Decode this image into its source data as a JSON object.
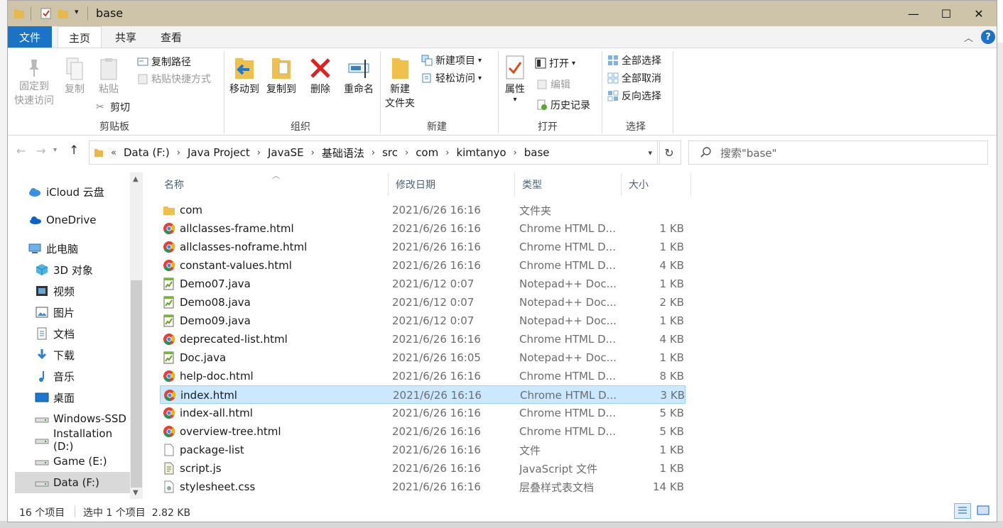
{
  "window": {
    "title": "base",
    "minimize": "—",
    "maximize": "☐",
    "close": "✕"
  },
  "ribbon_tabs": [
    "文件",
    "主页",
    "共享",
    "查看"
  ],
  "ribbon": {
    "clipboard": {
      "pin_line1": "固定到",
      "pin_line2": "快速访问",
      "copy": "复制",
      "paste": "粘贴",
      "copy_path": "复制路径",
      "paste_shortcut": "粘贴快捷方式",
      "cut": "剪切",
      "label": "剪贴板"
    },
    "organize": {
      "move_to": "移动到",
      "copy_to": "复制到",
      "delete": "删除",
      "rename": "重命名",
      "label": "组织"
    },
    "new": {
      "new_folder_line1": "新建",
      "new_folder_line2": "文件夹",
      "new_item": "新建项目",
      "easy_access": "轻松访问",
      "label": "新建"
    },
    "open": {
      "properties": "属性",
      "open": "打开",
      "edit": "编辑",
      "history": "历史记录",
      "label": "打开"
    },
    "select": {
      "select_all": "全部选择",
      "select_none": "全部取消",
      "invert": "反向选择",
      "label": "选择"
    }
  },
  "address": {
    "crumbs": [
      "Data (F:)",
      "Java Project",
      "JavaSE",
      "基础语法",
      "src",
      "com",
      "kimtanyo",
      "base"
    ],
    "overflow": "«",
    "search_placeholder": "搜索\"base\""
  },
  "nav": [
    {
      "label": "iCloud 云盘",
      "icon": "icloud-icon"
    },
    {
      "label": "OneDrive",
      "icon": "onedrive-icon"
    },
    {
      "label": "此电脑",
      "icon": "this-pc-icon"
    },
    {
      "label": "3D 对象",
      "icon": "3d-objects-icon"
    },
    {
      "label": "视频",
      "icon": "videos-icon"
    },
    {
      "label": "图片",
      "icon": "pictures-icon"
    },
    {
      "label": "文档",
      "icon": "documents-icon"
    },
    {
      "label": "下载",
      "icon": "downloads-icon"
    },
    {
      "label": "音乐",
      "icon": "music-icon"
    },
    {
      "label": "桌面",
      "icon": "desktop-icon"
    },
    {
      "label": "Windows-SSD",
      "icon": "drive-icon"
    },
    {
      "label": "Installation (D:)",
      "icon": "drive-icon"
    },
    {
      "label": "Game (E:)",
      "icon": "drive-icon"
    },
    {
      "label": "Data (F:)",
      "icon": "drive-icon"
    }
  ],
  "columns": {
    "name": "名称",
    "date": "修改日期",
    "type": "类型",
    "size": "大小"
  },
  "files": [
    {
      "name": "com",
      "date": "2021/6/26 16:16",
      "type": "文件夹",
      "size": "",
      "icon": "folder"
    },
    {
      "name": "allclasses-frame.html",
      "date": "2021/6/26 16:16",
      "type": "Chrome HTML D...",
      "size": "1 KB",
      "icon": "chrome"
    },
    {
      "name": "allclasses-noframe.html",
      "date": "2021/6/26 16:16",
      "type": "Chrome HTML D...",
      "size": "1 KB",
      "icon": "chrome"
    },
    {
      "name": "constant-values.html",
      "date": "2021/6/26 16:16",
      "type": "Chrome HTML D...",
      "size": "4 KB",
      "icon": "chrome"
    },
    {
      "name": "Demo07.java",
      "date": "2021/6/12 0:07",
      "type": "Notepad++ Doc...",
      "size": "1 KB",
      "icon": "notepad"
    },
    {
      "name": "Demo08.java",
      "date": "2021/6/12 0:07",
      "type": "Notepad++ Doc...",
      "size": "2 KB",
      "icon": "notepad"
    },
    {
      "name": "Demo09.java",
      "date": "2021/6/12 0:07",
      "type": "Notepad++ Doc...",
      "size": "1 KB",
      "icon": "notepad"
    },
    {
      "name": "deprecated-list.html",
      "date": "2021/6/26 16:16",
      "type": "Chrome HTML D...",
      "size": "4 KB",
      "icon": "chrome"
    },
    {
      "name": "Doc.java",
      "date": "2021/6/26 16:05",
      "type": "Notepad++ Doc...",
      "size": "1 KB",
      "icon": "notepad"
    },
    {
      "name": "help-doc.html",
      "date": "2021/6/26 16:16",
      "type": "Chrome HTML D...",
      "size": "8 KB",
      "icon": "chrome"
    },
    {
      "name": "index.html",
      "date": "2021/6/26 16:16",
      "type": "Chrome HTML D...",
      "size": "3 KB",
      "icon": "chrome",
      "selected": true
    },
    {
      "name": "index-all.html",
      "date": "2021/6/26 16:16",
      "type": "Chrome HTML D...",
      "size": "5 KB",
      "icon": "chrome"
    },
    {
      "name": "overview-tree.html",
      "date": "2021/6/26 16:16",
      "type": "Chrome HTML D...",
      "size": "5 KB",
      "icon": "chrome"
    },
    {
      "name": "package-list",
      "date": "2021/6/26 16:16",
      "type": "文件",
      "size": "1 KB",
      "icon": "blank"
    },
    {
      "name": "script.js",
      "date": "2021/6/26 16:16",
      "type": "JavaScript 文件",
      "size": "1 KB",
      "icon": "script"
    },
    {
      "name": "stylesheet.css",
      "date": "2021/6/26 16:16",
      "type": "层叠样式表文档",
      "size": "14 KB",
      "icon": "css"
    }
  ],
  "status": {
    "count": "16 个项目",
    "selection": "选中 1 个项目  2.82 KB"
  },
  "colors": {
    "titlebar": "#cdc4aa",
    "file_tab": "#1a73c6",
    "selection": "#cce8ff",
    "selection_border": "#99d1ff"
  }
}
